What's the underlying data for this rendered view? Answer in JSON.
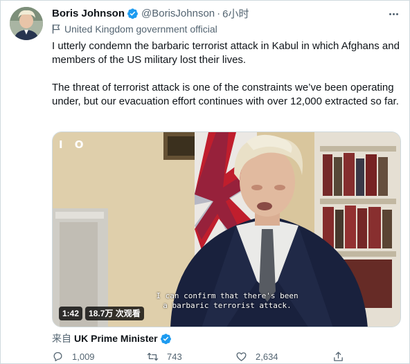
{
  "tweet": {
    "author": {
      "display_name": "Boris Johnson",
      "handle": "@BorisJohnson",
      "verified": true,
      "avatar_icon": "avatar-photo"
    },
    "separator": "·",
    "time": "6小时",
    "label": {
      "icon": "flag-icon",
      "text": "United Kingdom government official"
    },
    "paragraphs": [
      "I utterly condemn the barbaric terrorist attack in Kabul in which Afghans and members of the US military lost their lives.",
      "The threat of terrorist attack is one of the constraints we’ve been operating under, but our evacuation effort continues with over 12,000 extracted so far."
    ],
    "media": {
      "type": "video",
      "logo": "I O",
      "subtitle_line1": "I can confirm that there's been",
      "subtitle_line2": "a barbaric terrorist attack.",
      "duration": "1:42",
      "views": "18.7万 次观看"
    },
    "source": {
      "prefix": "来自",
      "name": "UK Prime Minister",
      "verified": true
    },
    "actions": {
      "replies": "1,009",
      "retweets": "743",
      "likes": "2,634"
    }
  },
  "colors": {
    "verified_blue": "#1d9bf0",
    "text_primary": "#0f1419",
    "text_secondary": "#536471",
    "border": "#cfd9de"
  }
}
